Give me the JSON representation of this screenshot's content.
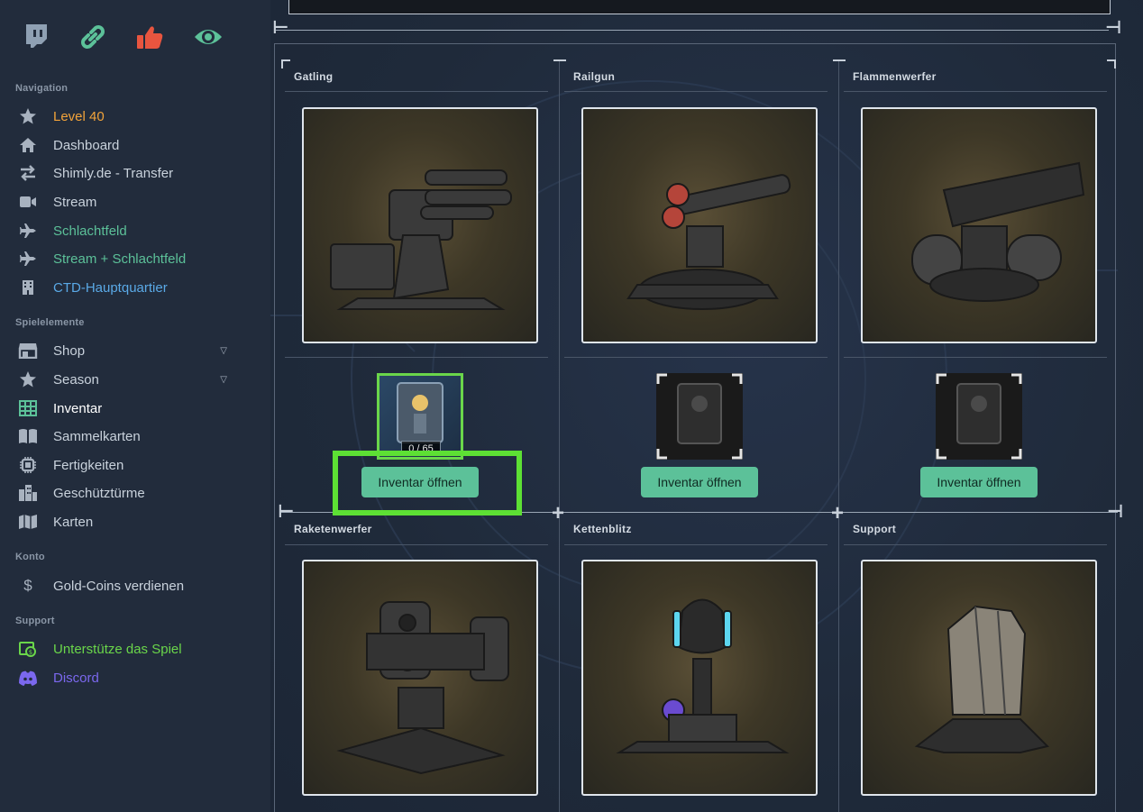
{
  "sidebar": {
    "top_icons": [
      "twitch-icon",
      "link-icon",
      "thumbs-up-icon",
      "eye-icon"
    ],
    "sections": {
      "navigation": "Navigation",
      "spielelemente": "Spielelemente",
      "konto": "Konto",
      "support": "Support"
    },
    "items": {
      "level": "Level 40",
      "dashboard": "Dashboard",
      "transfer": "Shimly.de - Transfer",
      "stream": "Stream",
      "schlachtfeld": "Schlachtfeld",
      "stream_schlachtfeld": "Stream + Schlachtfeld",
      "hauptquartier": "CTD-Hauptquartier",
      "shop": "Shop",
      "season": "Season",
      "inventar": "Inventar",
      "sammelkarten": "Sammelkarten",
      "fertigkeiten": "Fertigkeiten",
      "geschuetztuerme": "Geschütztürme",
      "karten": "Karten",
      "gold_coins": "Gold-Coins verdienen",
      "unterstuetze": "Unterstütze das Spiel",
      "discord": "Discord"
    },
    "colors": {
      "level": "#f2a33a",
      "schlachtfeld": "#5cc199",
      "hauptquartier": "#5aa9e6",
      "unterstuetze": "#6ad64a",
      "discord": "#7b68ee",
      "twitch_icon": "#8fa0b3",
      "link_icon": "#5cc199",
      "thumbs_icon": "#e8553f",
      "eye_icon": "#5cc199"
    }
  },
  "towers": [
    {
      "title": "Gatling",
      "slot_count": "0 / 65",
      "button": "Inventar öffnen"
    },
    {
      "title": "Railgun",
      "button": "Inventar öffnen"
    },
    {
      "title": "Flammenwerfer",
      "button": "Inventar öffnen"
    },
    {
      "title": "Raketenwerfer"
    },
    {
      "title": "Kettenblitz"
    },
    {
      "title": "Support"
    }
  ],
  "colors": {
    "accent_button": "#5cc199",
    "highlight": "#5de034"
  }
}
